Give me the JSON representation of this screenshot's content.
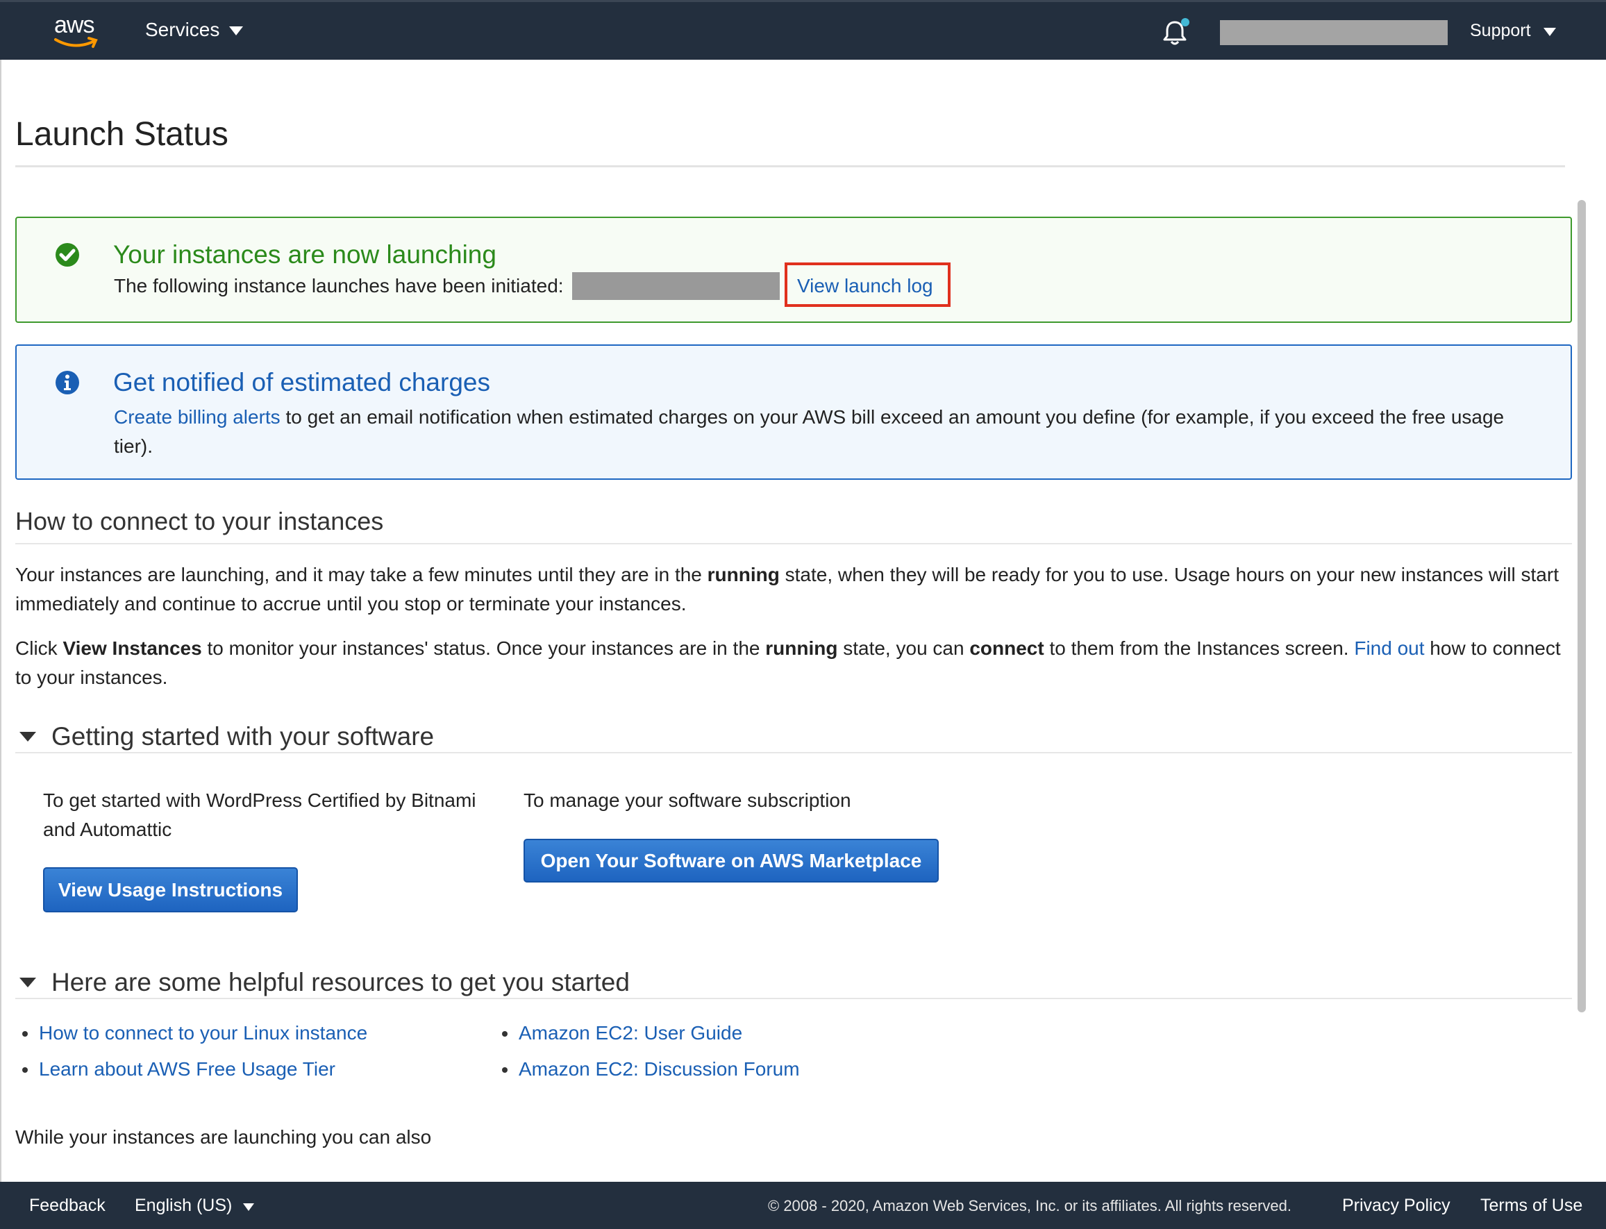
{
  "nav": {
    "logo_text": "aws",
    "services_label": "Services",
    "support_label": "Support"
  },
  "page": {
    "title": "Launch Status"
  },
  "success_alert": {
    "title": "Your instances are now launching",
    "text": "The following instance launches have been initiated:",
    "link": "View launch log"
  },
  "info_alert": {
    "title": "Get notified of estimated charges",
    "link": "Create billing alerts",
    "text": "to get an email notification when estimated charges on your AWS bill exceed an amount you define (for example, if you exceed the free usage tier)."
  },
  "connect": {
    "heading": "How to connect to your instances",
    "p1_a": "Your instances are launching, and it may take a few minutes until they are in the ",
    "p1_b": "running",
    "p1_c": " state, when they will be ready for you to use. Usage hours on your new instances will start immediately and continue to accrue until you stop or terminate your instances.",
    "p2_a": "Click ",
    "p2_b": "View Instances",
    "p2_c": " to monitor your instances' status. Once your instances are in the ",
    "p2_d": "running",
    "p2_e": " state, you can ",
    "p2_f": "connect",
    "p2_g": " to them from the Instances screen. ",
    "p2_link": "Find out",
    "p2_h": " how to connect to your instances."
  },
  "software": {
    "heading": "Getting started with your software",
    "left_text": "To get started with WordPress Certified by Bitnami and Automattic",
    "left_button": "View Usage Instructions",
    "right_text": "To manage your software subscription",
    "right_button": "Open Your Software on AWS Marketplace"
  },
  "resources": {
    "heading": "Here are some helpful resources to get you started",
    "left": [
      "How to connect to your Linux instance",
      "Learn about AWS Free Usage Tier"
    ],
    "right": [
      "Amazon EC2: User Guide",
      "Amazon EC2: Discussion Forum"
    ]
  },
  "while_text": "While your instances are launching you can also",
  "footer": {
    "feedback": "Feedback",
    "language": "English (US)",
    "copyright": "© 2008 - 2020, Amazon Web Services, Inc. or its affiliates. All rights reserved.",
    "privacy": "Privacy Policy",
    "terms": "Terms of Use"
  },
  "colors": {
    "nav_bg": "#232f3e",
    "success": "#2b8a1b",
    "info": "#1a5fb4",
    "highlight": "#e0301e",
    "button": "#1e64c0"
  },
  "icons": [
    "aws-logo",
    "chevron-down-icon",
    "bell-icon",
    "check-circle-icon",
    "info-icon",
    "collapse-triangle-icon"
  ]
}
